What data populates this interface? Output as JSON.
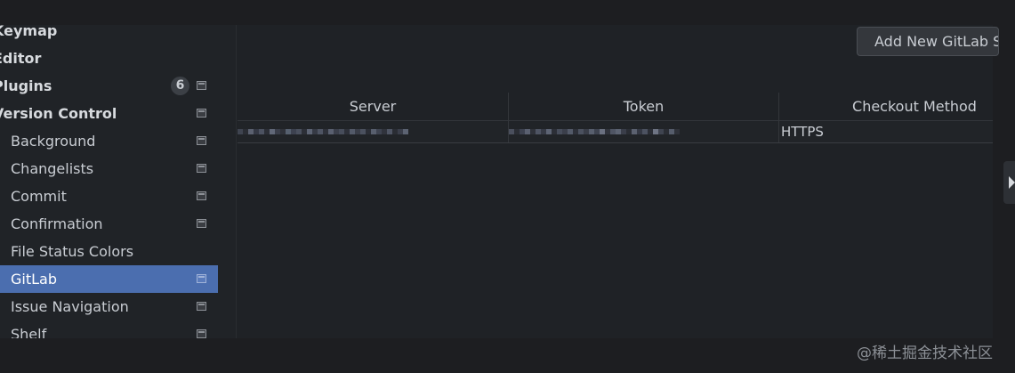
{
  "sidebar": {
    "items": [
      {
        "label": "Keymap",
        "level": "top",
        "badge": "",
        "project_icon": false,
        "selected": false
      },
      {
        "label": "Editor",
        "level": "top",
        "badge": "",
        "project_icon": false,
        "selected": false
      },
      {
        "label": "Plugins",
        "level": "top",
        "badge": "6",
        "project_icon": true,
        "selected": false
      },
      {
        "label": "Version Control",
        "level": "top",
        "badge": "",
        "project_icon": true,
        "selected": false
      },
      {
        "label": "Background",
        "level": "child",
        "badge": "",
        "project_icon": true,
        "selected": false
      },
      {
        "label": "Changelists",
        "level": "child",
        "badge": "",
        "project_icon": true,
        "selected": false
      },
      {
        "label": "Commit",
        "level": "child",
        "badge": "",
        "project_icon": true,
        "selected": false
      },
      {
        "label": "Confirmation",
        "level": "child",
        "badge": "",
        "project_icon": true,
        "selected": false
      },
      {
        "label": "File Status Colors",
        "level": "child",
        "badge": "",
        "project_icon": false,
        "selected": false
      },
      {
        "label": "GitLab",
        "level": "child",
        "badge": "",
        "project_icon": true,
        "selected": true
      },
      {
        "label": "Issue Navigation",
        "level": "child",
        "badge": "",
        "project_icon": true,
        "selected": false
      },
      {
        "label": "Shelf",
        "level": "child",
        "badge": "",
        "project_icon": true,
        "selected": false
      }
    ]
  },
  "main": {
    "add_button_label": "Add New GitLab S",
    "table": {
      "columns": [
        "Server",
        "Token",
        "Checkout Method"
      ],
      "rows": [
        {
          "server": "",
          "token": "",
          "checkout_method": "HTTPS"
        }
      ]
    }
  },
  "watermark": "@稀土掘金技术社区",
  "colors": {
    "selection": "#4b6eaf",
    "background": "#1f2226",
    "sidebar_background": "#202327"
  },
  "icons": {
    "project_level": "project-settings-icon",
    "edge_toggle": "chevron-right-icon"
  }
}
